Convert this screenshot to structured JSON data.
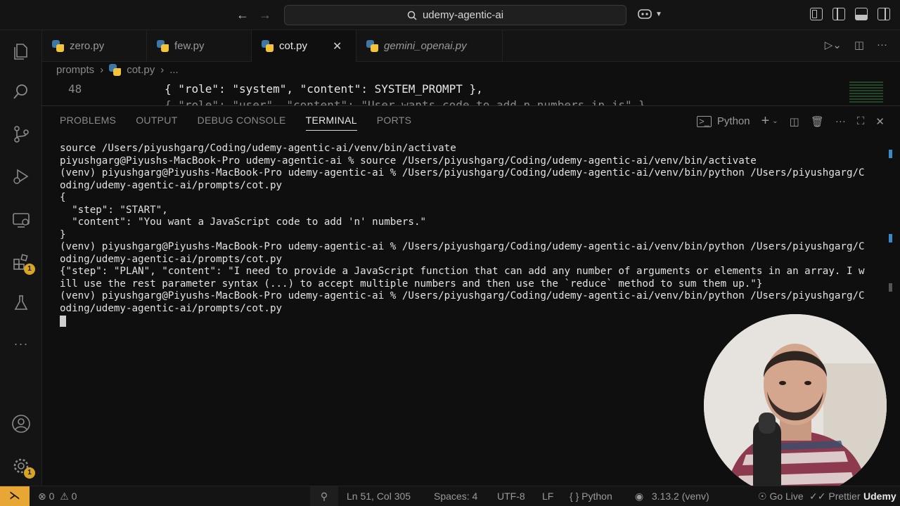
{
  "titlebar": {
    "search_text": "udemy-agentic-ai",
    "copilot_icon": "copilot-icon"
  },
  "activity_bar": {
    "extensions_badge": "1",
    "settings_badge": "1"
  },
  "tabs": [
    {
      "label": "zero.py",
      "active": false,
      "italic": false
    },
    {
      "label": "few.py",
      "active": false,
      "italic": false
    },
    {
      "label": "cot.py",
      "active": true,
      "italic": false
    },
    {
      "label": "gemini_openai.py",
      "active": false,
      "italic": true
    }
  ],
  "breadcrumb": {
    "folder": "prompts",
    "file": "cot.py",
    "more": "..."
  },
  "editor": {
    "line_number": "48",
    "line_code": "{ \"role\": \"system\", \"content\": SYSTEM_PROMPT },",
    "next_line_code": "{ \"role\": \"user\", \"content\": \"User wants code to add n numbers in js\" },"
  },
  "panel": {
    "tabs": [
      "PROBLEMS",
      "OUTPUT",
      "DEBUG CONSOLE",
      "TERMINAL",
      "PORTS"
    ],
    "active_tab": "TERMINAL",
    "terminal_name": "Python"
  },
  "terminal_lines": [
    {
      "text": "source /Users/piyushgarg/Coding/udemy-agentic-ai/venv/bin/activate",
      "marker": ""
    },
    {
      "text": "piyushgarg@Piyushs-MacBook-Pro udemy-agentic-ai % source /Users/piyushgarg/Coding/udemy-agentic-ai/venv/bin/activate",
      "marker": "dot"
    },
    {
      "text": "(venv) piyushgarg@Piyushs-MacBook-Pro udemy-agentic-ai % /Users/piyushgarg/Coding/udemy-agentic-ai/venv/bin/python /Users/piyushgarg/C",
      "marker": "dot"
    },
    {
      "text": "oding/udemy-agentic-ai/prompts/cot.py",
      "marker": ""
    },
    {
      "text": "{",
      "marker": ""
    },
    {
      "text": "  \"step\": \"START\",",
      "marker": ""
    },
    {
      "text": "  \"content\": \"You want a JavaScript code to add 'n' numbers.\"",
      "marker": ""
    },
    {
      "text": "}",
      "marker": ""
    },
    {
      "text": "(venv) piyushgarg@Piyushs-MacBook-Pro udemy-agentic-ai % /Users/piyushgarg/Coding/udemy-agentic-ai/venv/bin/python /Users/piyushgarg/C",
      "marker": "dot"
    },
    {
      "text": "oding/udemy-agentic-ai/prompts/cot.py",
      "marker": ""
    },
    {
      "text": "{\"step\": \"PLAN\", \"content\": \"I need to provide a JavaScript function that can add any number of arguments or elements in an array. I w",
      "marker": ""
    },
    {
      "text": "ill use the rest parameter syntax (...) to accept multiple numbers and then use the `reduce` method to sum them up.\"}",
      "marker": ""
    },
    {
      "text": "(venv) piyushgarg@Piyushs-MacBook-Pro udemy-agentic-ai % /Users/piyushgarg/Coding/udemy-agentic-ai/venv/bin/python /Users/piyushgarg/C",
      "marker": "sparkle"
    },
    {
      "text": "oding/udemy-agentic-ai/prompts/cot.py",
      "marker": ""
    }
  ],
  "statusbar": {
    "errors": "0",
    "warnings": "0",
    "position": "Ln 51, Col 305",
    "spaces": "Spaces: 4",
    "encoding": "UTF-8",
    "eol": "LF",
    "language": "Python",
    "interpreter": "3.13.2 (venv)",
    "golive": "Go Live",
    "prettier": "Prettier",
    "watermark": "Udemy"
  }
}
